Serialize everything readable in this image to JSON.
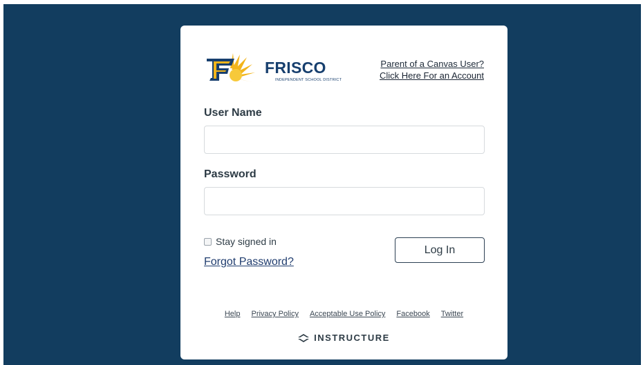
{
  "district": {
    "logo_word": "FRISCO",
    "logo_subtitle": "INDEPENDENT SCHOOL DISTRICT",
    "logo_icon": "frisco-f-sun-logo"
  },
  "parent_links": {
    "line1": "Parent of a Canvas User?",
    "line2": "Click Here For an Account"
  },
  "form": {
    "username_label": "User Name",
    "username_value": "",
    "password_label": "Password",
    "password_value": "",
    "stay_signed_in_label": "Stay signed in",
    "stay_signed_in_checked": false,
    "forgot_password": "Forgot Password?",
    "login_button": "Log In"
  },
  "footer": {
    "links": [
      "Help",
      "Privacy Policy",
      "Acceptable Use Policy",
      "Facebook",
      "Twitter"
    ],
    "brand": "INSTRUCTURE",
    "brand_icon": "instructure-chevron-icon"
  },
  "colors": {
    "background": "#123d5f",
    "card": "#ffffff",
    "logo_blue": "#173f6e",
    "logo_gold": "#f2b51c"
  }
}
